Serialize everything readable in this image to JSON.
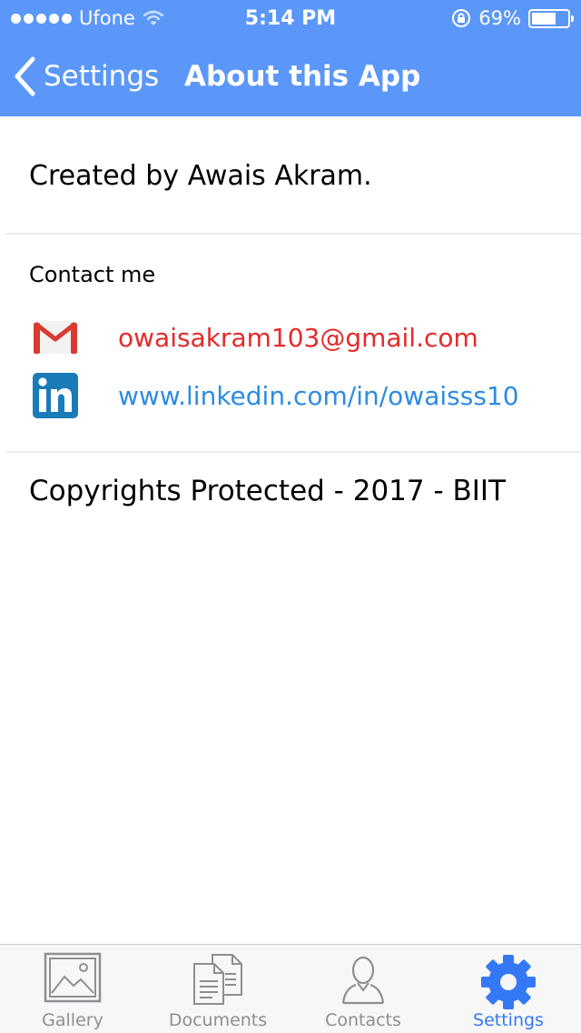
{
  "status_bar": {
    "carrier": "Ufone",
    "time": "5:14 PM",
    "battery_percent": "69%",
    "battery_level": 0.69
  },
  "nav": {
    "back_label": "Settings",
    "title": "About this App"
  },
  "content": {
    "created_by": "Created by Awais Akram.",
    "contact_title": "Contact me",
    "email": "owaisakram103@gmail.com",
    "linkedin": "www.linkedin.com/in/owaisss10",
    "copyright": "Copyrights Protected - 2017 - BIIT"
  },
  "tabs": [
    {
      "label": "Gallery",
      "icon": "gallery-icon"
    },
    {
      "label": "Documents",
      "icon": "documents-icon"
    },
    {
      "label": "Contacts",
      "icon": "contacts-icon"
    },
    {
      "label": "Settings",
      "icon": "gear-icon",
      "active": true
    }
  ],
  "colors": {
    "header": "#5b97f9",
    "email": "#e52a2a",
    "linkedin": "#2d8be3",
    "tab_active": "#3478f6",
    "tab_inactive": "#8e8e93"
  }
}
